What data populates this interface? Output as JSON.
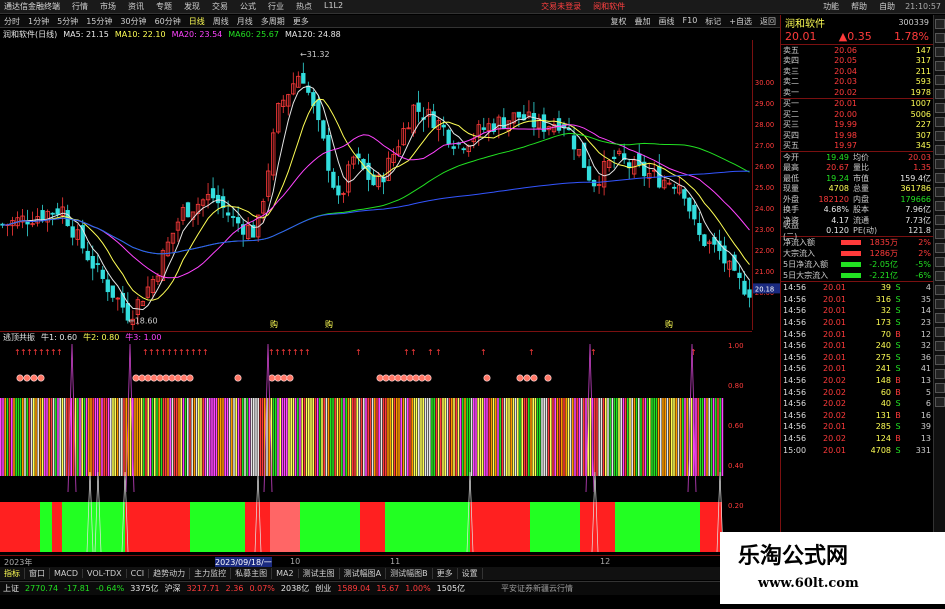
{
  "app": {
    "title": "通达信金融终端",
    "menu": [
      "行情",
      "市场",
      "资讯",
      "专题",
      "发现",
      "交易",
      "公式",
      "行业",
      "热点",
      "L1L2"
    ],
    "banners": [
      "交易未登录",
      "阅和软件"
    ],
    "right_menu": [
      "功能",
      "帮助",
      "自助"
    ],
    "time": "21:10:57"
  },
  "toolbar": {
    "periods": [
      "分时",
      "1分钟",
      "5分钟",
      "15分钟",
      "30分钟",
      "60分钟",
      "日线",
      "周线",
      "月线",
      "多周期",
      "更多"
    ],
    "active_index": 6,
    "right": [
      "复权",
      "叠加",
      "画线",
      "F10",
      "标记",
      "+自选",
      "返回"
    ]
  },
  "ma_legend": {
    "stock": "润和软件(日线)",
    "items": [
      {
        "label": "MA5: 21.15",
        "color": "#e6e6e6"
      },
      {
        "label": "MA10: 22.10",
        "color": "#ffff55"
      },
      {
        "label": "MA20: 23.54",
        "color": "#ff44ff"
      },
      {
        "label": "MA60: 25.67",
        "color": "#22e022"
      },
      {
        "label": "MA120: 24.88",
        "color": "#e6e6e6"
      }
    ]
  },
  "kchart": {
    "high_label": "31.32",
    "low_label": "18.60",
    "price_axis": [
      "30.00",
      "29.00",
      "28.00",
      "27.00",
      "26.00",
      "25.00",
      "24.00",
      "23.00",
      "22.00",
      "21.00",
      "20.00"
    ],
    "current_marker": "20.18",
    "ymin": 18.2,
    "ymax": 32.0,
    "flags": [
      "购",
      "购",
      "购"
    ]
  },
  "chart_data": {
    "type": "candlestick",
    "ylim": [
      18.2,
      32.0
    ],
    "ma_lines": [
      {
        "label": "MA5",
        "color": "#e6e6e6"
      },
      {
        "label": "MA10",
        "color": "#ffff55"
      },
      {
        "label": "MA20",
        "color": "#ff44ff"
      },
      {
        "label": "MA60",
        "color": "#22e022"
      },
      {
        "label": "MA120",
        "color": "#e6e6e6"
      }
    ]
  },
  "indicator": {
    "name": "逃顶共振",
    "items": [
      {
        "label": "牛1: 0.60",
        "color": "#e6e6e6"
      },
      {
        "label": "牛2: 0.80",
        "color": "#ffff55"
      },
      {
        "label": "牛3: 1.00",
        "color": "#ff44ff"
      }
    ],
    "axis": [
      "1.00",
      "0.80",
      "0.60",
      "0.40",
      "0.20",
      "0.00"
    ]
  },
  "datebar": {
    "labels": [
      "2023年",
      "2023/09/18/一",
      "10",
      "11",
      "12"
    ]
  },
  "tabs": [
    "指标",
    "窗口",
    "MACD",
    "VOL-TDX",
    "CCI",
    "趋势动力",
    "主力监控",
    "私募主图",
    "MA2",
    "测试主图",
    "测试幅图A",
    "测试幅图B",
    "更多",
    "设置"
  ],
  "tabs_row2": [
    "扩展A",
    "关联报价",
    "资金分布",
    "综合资讯",
    "行业资讯",
    "互动问答",
    "最及新功能说明"
  ],
  "status": {
    "sh_label": "上证",
    "sh_val": "2770.74",
    "sh_chg": "-17.81",
    "sh_pct": "-0.64%",
    "sh_amt": "3375亿",
    "hs_label": "沪深",
    "hs_val": "3217.71",
    "hs_chg": "2.36",
    "hs_pct": "0.07%",
    "hs_amt": "2038亿",
    "cy_label": "创业",
    "cy_val": "1589.04",
    "cy_chg": "15.67",
    "cy_pct": "1.00%",
    "cy_amt": "1505亿",
    "broker": "平安证券新疆云行情"
  },
  "quote": {
    "name": "润和软件",
    "code": "300339",
    "price": "20.01",
    "change": "▲0.35",
    "pct": "1.78%",
    "asks": [
      {
        "label": "卖五",
        "price": "20.06",
        "vol": "147"
      },
      {
        "label": "卖四",
        "price": "20.05",
        "vol": "317"
      },
      {
        "label": "卖三",
        "price": "20.04",
        "vol": "211"
      },
      {
        "label": "卖二",
        "price": "20.03",
        "vol": "593"
      },
      {
        "label": "卖一",
        "price": "20.02",
        "vol": "1978"
      }
    ],
    "bids": [
      {
        "label": "买一",
        "price": "20.01",
        "vol": "1007"
      },
      {
        "label": "买二",
        "price": "20.00",
        "vol": "5006"
      },
      {
        "label": "买三",
        "price": "19.99",
        "vol": "227"
      },
      {
        "label": "买四",
        "price": "19.98",
        "vol": "307"
      },
      {
        "label": "买五",
        "price": "19.97",
        "vol": "345"
      }
    ],
    "stats": [
      {
        "a": "今开",
        "b": "19.49",
        "bc": "green",
        "c": "均价",
        "d": "20.03",
        "dc": "red"
      },
      {
        "a": "最高",
        "b": "20.67",
        "bc": "red",
        "c": "量比",
        "d": "1.35",
        "dc": "red"
      },
      {
        "a": "最低",
        "b": "19.24",
        "bc": "green",
        "c": "市值",
        "d": "159.4亿",
        "dc": "white"
      },
      {
        "a": "现量",
        "b": "4708",
        "bc": "yellow",
        "c": "总量",
        "d": "361786",
        "dc": "yellow"
      },
      {
        "a": "外盘",
        "b": "182120",
        "bc": "red",
        "c": "内盘",
        "d": "179666",
        "dc": "green"
      },
      {
        "a": "换手",
        "b": "4.68%",
        "bc": "white",
        "c": "股本",
        "d": "7.96亿",
        "dc": "white"
      },
      {
        "a": "净资",
        "b": "4.17",
        "bc": "white",
        "c": "流通",
        "d": "7.73亿",
        "dc": "white"
      },
      {
        "a": "收益(二)",
        "b": "0.120",
        "bc": "white",
        "c": "PE(动)",
        "d": "121.8",
        "dc": "white"
      }
    ],
    "flows": [
      {
        "k": "净流入额",
        "v": "1835万",
        "u": "2%",
        "vc": "red",
        "bar": "#ff3b3b"
      },
      {
        "k": "大宗流入",
        "v": "1286万",
        "u": "2%",
        "vc": "red",
        "bar": "#ff3b3b"
      },
      {
        "k": "5日净流入额",
        "v": "-2.05亿",
        "u": "-5%",
        "vc": "green",
        "bar": "#22e022"
      },
      {
        "k": "5日大宗流入",
        "v": "-2.21亿",
        "u": "-6%",
        "vc": "green",
        "bar": "#22e022"
      }
    ],
    "ticks": [
      {
        "t": "14:56",
        "p": "20.01",
        "v": "39",
        "bs": "S",
        "n": "4"
      },
      {
        "t": "14:56",
        "p": "20.01",
        "v": "316",
        "bs": "S",
        "n": "35"
      },
      {
        "t": "14:56",
        "p": "20.01",
        "v": "32",
        "bs": "S",
        "n": "14"
      },
      {
        "t": "14:56",
        "p": "20.01",
        "v": "173",
        "bs": "S",
        "n": "23"
      },
      {
        "t": "14:56",
        "p": "20.01",
        "v": "70",
        "bs": "B",
        "n": "12"
      },
      {
        "t": "14:56",
        "p": "20.01",
        "v": "240",
        "bs": "S",
        "n": "32"
      },
      {
        "t": "14:56",
        "p": "20.01",
        "v": "275",
        "bs": "S",
        "n": "36"
      },
      {
        "t": "14:56",
        "p": "20.01",
        "v": "241",
        "bs": "S",
        "n": "41"
      },
      {
        "t": "14:56",
        "p": "20.02",
        "v": "148",
        "bs": "B",
        "n": "13"
      },
      {
        "t": "14:56",
        "p": "20.02",
        "v": "60",
        "bs": "B",
        "n": "5"
      },
      {
        "t": "14:56",
        "p": "20.02",
        "v": "40",
        "bs": "S",
        "n": "6"
      },
      {
        "t": "14:56",
        "p": "20.02",
        "v": "131",
        "bs": "B",
        "n": "16"
      },
      {
        "t": "14:56",
        "p": "20.01",
        "v": "285",
        "bs": "S",
        "n": "39"
      },
      {
        "t": "14:56",
        "p": "20.02",
        "v": "124",
        "bs": "B",
        "n": "13"
      },
      {
        "t": "15:00",
        "p": "20.01",
        "v": "4708",
        "bs": "S",
        "n": "331"
      }
    ]
  },
  "watermark": {
    "line1": "乐淘公式网",
    "line2": "www.60lt.com"
  }
}
